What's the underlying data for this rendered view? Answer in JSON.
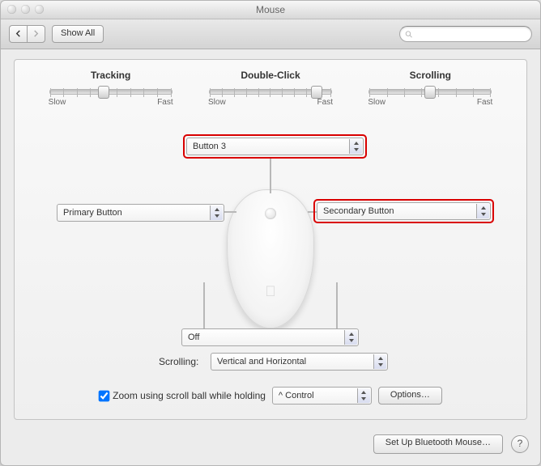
{
  "window": {
    "title": "Mouse"
  },
  "toolbar": {
    "show_all": "Show All",
    "search_placeholder": ""
  },
  "sliders": [
    {
      "label": "Tracking",
      "min": "Slow",
      "max": "Fast",
      "value": 4,
      "max_steps": 10
    },
    {
      "label": "Double-Click",
      "min": "Slow",
      "max": "Fast",
      "value": 9,
      "max_steps": 11
    },
    {
      "label": "Scrolling",
      "min": "Slow",
      "max": "Fast",
      "value": 4,
      "max_steps": 8
    }
  ],
  "assignments": {
    "top": "Button 3",
    "left": "Primary Button",
    "right": "Secondary Button",
    "squeeze": "Off"
  },
  "scrolling": {
    "label": "Scrolling:",
    "value": "Vertical and Horizontal"
  },
  "zoom": {
    "checked": true,
    "label": "Zoom using scroll ball while holding",
    "modifier": "^ Control",
    "options": "Options…"
  },
  "footer": {
    "bluetooth": "Set Up Bluetooth Mouse…"
  }
}
